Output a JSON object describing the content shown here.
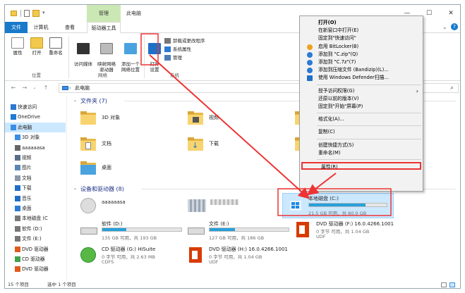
{
  "window": {
    "context_tab": "管理",
    "title": "此电脑",
    "controls": [
      "—",
      "☐",
      "✕"
    ]
  },
  "tabs": [
    "文件",
    "计算机",
    "查看",
    "驱动器工具"
  ],
  "ribbon": {
    "buttons": [
      {
        "label": "属性",
        "icon": "properties-icon"
      },
      {
        "label": "打开",
        "icon": "open-icon"
      },
      {
        "label": "重命名",
        "icon": "rename-icon"
      },
      {
        "label": "访问媒体",
        "icon": "media-icon"
      },
      {
        "label": "映射网络\n驱动器",
        "icon": "map-drive-icon"
      },
      {
        "label": "添加一个\n网络位置",
        "icon": "add-network-icon"
      },
      {
        "label": "打开\n设置",
        "icon": "settings-icon"
      }
    ],
    "small_buttons": [
      "卸载或更改程序",
      "系统属性",
      "管理"
    ],
    "groups": [
      "位置",
      "网络",
      "系统"
    ]
  },
  "address": {
    "path": "此电脑",
    "search_icon": "⌕"
  },
  "nav": {
    "items": [
      {
        "label": "快速访问",
        "icon": "star-icon",
        "color": "#2b79d0"
      },
      {
        "label": "OneDrive",
        "icon": "cloud-icon",
        "color": "#1f7ad4"
      },
      {
        "label": "此电脑",
        "icon": "pc-icon",
        "color": "#3a8ee6",
        "selected": true
      },
      {
        "label": "3D 对象",
        "icon": "3d-icon",
        "color": "#3a8ee6"
      },
      {
        "label": "aaaaaasa",
        "icon": "user-icon",
        "color": "#666"
      },
      {
        "label": "视频",
        "icon": "video-icon",
        "color": "#5a6e86"
      },
      {
        "label": "图片",
        "icon": "picture-icon",
        "color": "#5a86b6"
      },
      {
        "label": "文档",
        "icon": "document-icon",
        "color": "#8a98a8"
      },
      {
        "label": "下载",
        "icon": "download-icon",
        "color": "#1f6fc6"
      },
      {
        "label": "音乐",
        "icon": "music-icon",
        "color": "#1f6fc6"
      },
      {
        "label": "桌面",
        "icon": "desktop-icon",
        "color": "#2b7ad6"
      },
      {
        "label": "本地磁盘 (C",
        "icon": "drive-icon",
        "color": "#777"
      },
      {
        "label": "软件 (D:)",
        "icon": "drive-icon",
        "color": "#777"
      },
      {
        "label": "文件 (E:)",
        "icon": "drive-icon",
        "color": "#777"
      },
      {
        "label": "DVD 驱动器",
        "icon": "dvd-icon",
        "color": "#e25a1c"
      },
      {
        "label": "CD 驱动器",
        "icon": "cd-icon",
        "color": "#3fa34d"
      },
      {
        "label": "DVD 驱动器",
        "icon": "dvd-icon",
        "color": "#e25a1c"
      }
    ]
  },
  "content": {
    "folders_header": "文件夹 (7)",
    "folders": [
      {
        "label": "3D 对象"
      },
      {
        "label": "视频"
      },
      {
        "label": "文档"
      },
      {
        "label": "下载"
      },
      {
        "label": "桌面"
      }
    ],
    "devices_header": "设备和驱动器 (8)",
    "devices": [
      {
        "name": "aaaaaasa",
        "sub": "",
        "fill": null,
        "icon": "camera-icon"
      },
      {
        "name": "",
        "sub": "",
        "fill": null,
        "icon": "network-device-icon"
      },
      {
        "name": "本地磁盘 (C:)",
        "sub": "21.5 GB 可用，共 80.0 GB",
        "fill": 0.73,
        "icon": "windows-drive-icon",
        "selected": true
      },
      {
        "name": "软件 (D:)",
        "sub": "135 GB 可用，共 193 GB",
        "fill": 0.3,
        "icon": "drive-icon"
      },
      {
        "name": "文件 (E:)",
        "sub": "127 GB 可用，共 186 GB",
        "fill": 0.32,
        "icon": "drive-icon"
      },
      {
        "name": "DVD 驱动器 (F:) 16.0.4266.1001",
        "sub": "0 字节 可用，共 1.04 GB",
        "sub2": "UDF",
        "fill": null,
        "icon": "office-icon"
      },
      {
        "name": "CD 驱动器 (G:) HiSuite",
        "sub": "0 字节 可用，共 2.63 MB",
        "sub2": "CDFS",
        "fill": null,
        "icon": "hisuite-icon"
      },
      {
        "name": "DVD 驱动器 (H:) 16.0.4266.1001",
        "sub": "0 字节 可用，共 1.04 GB",
        "sub2": "UDF",
        "fill": null,
        "icon": "office-icon"
      }
    ]
  },
  "status": {
    "count": "15 个项目",
    "selected": "选中 1 个项目"
  },
  "context_menu": {
    "items": [
      {
        "label": "打开(O)",
        "bold": true
      },
      {
        "label": "在新窗口中打开(E)"
      },
      {
        "label": "固定到\"快速访问\""
      },
      {
        "label": "启用 BitLocker(B)",
        "icon": "shield-icon"
      },
      {
        "label": "添加到 \"C.zip\"(Q)",
        "icon": "bandizip-icon"
      },
      {
        "label": "添加到 \"C.7z\"(7)",
        "icon": "bandizip-icon"
      },
      {
        "label": "添加到压缩文件 (Bandizip)(L)...",
        "icon": "bandizip-icon"
      },
      {
        "label": "使用 Windows Defender扫描...",
        "icon": "defender-icon"
      },
      {
        "sep": true
      },
      {
        "label": "授予访问权限(G)",
        "sub": true
      },
      {
        "label": "还原以前的版本(V)"
      },
      {
        "label": "固定到\"开始\"屏幕(P)"
      },
      {
        "sep": true
      },
      {
        "label": "格式化(A)..."
      },
      {
        "sep": true
      },
      {
        "label": "复制(C)"
      },
      {
        "sep": true
      },
      {
        "label": "创建快捷方式(S)"
      },
      {
        "label": "重命名(M)"
      },
      {
        "sep": true
      },
      {
        "label": "属性(R)",
        "highlight": true
      }
    ]
  },
  "colors": {
    "accent": "#1979ca",
    "selection": "#cce8ff",
    "annotation": "#e33333"
  }
}
